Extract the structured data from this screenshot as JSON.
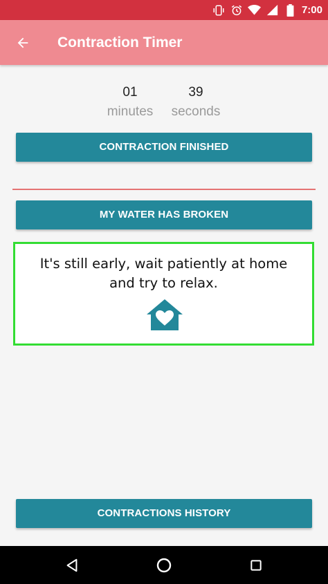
{
  "status_bar": {
    "time": "7:00",
    "icons": [
      "vibrate-icon",
      "alarm-icon",
      "wifi-icon",
      "signal-icon",
      "battery-icon"
    ]
  },
  "app_bar": {
    "title": "Contraction Timer",
    "back_icon": "arrow-back-icon"
  },
  "timer": {
    "minutes_value": "01",
    "minutes_label": "minutes",
    "seconds_value": "39",
    "seconds_label": "seconds"
  },
  "buttons": {
    "finished": "CONTRACTION FINISHED",
    "water_broken": "MY WATER HAS BROKEN",
    "history": "CONTRACTIONS HISTORY"
  },
  "advice": {
    "line1": "It's still early, wait patiently at home",
    "line2": "and try to relax.",
    "icon": "home-heart-icon"
  },
  "nav_bar": {
    "icons": [
      "nav-back-icon",
      "nav-home-icon",
      "nav-recent-icon"
    ]
  },
  "colors": {
    "status_bar": "#d2313f",
    "app_bar": "#ef8a91",
    "button": "#23889a",
    "divider": "#e57373",
    "card_border": "#33dd33",
    "home_icon": "#23889a"
  }
}
